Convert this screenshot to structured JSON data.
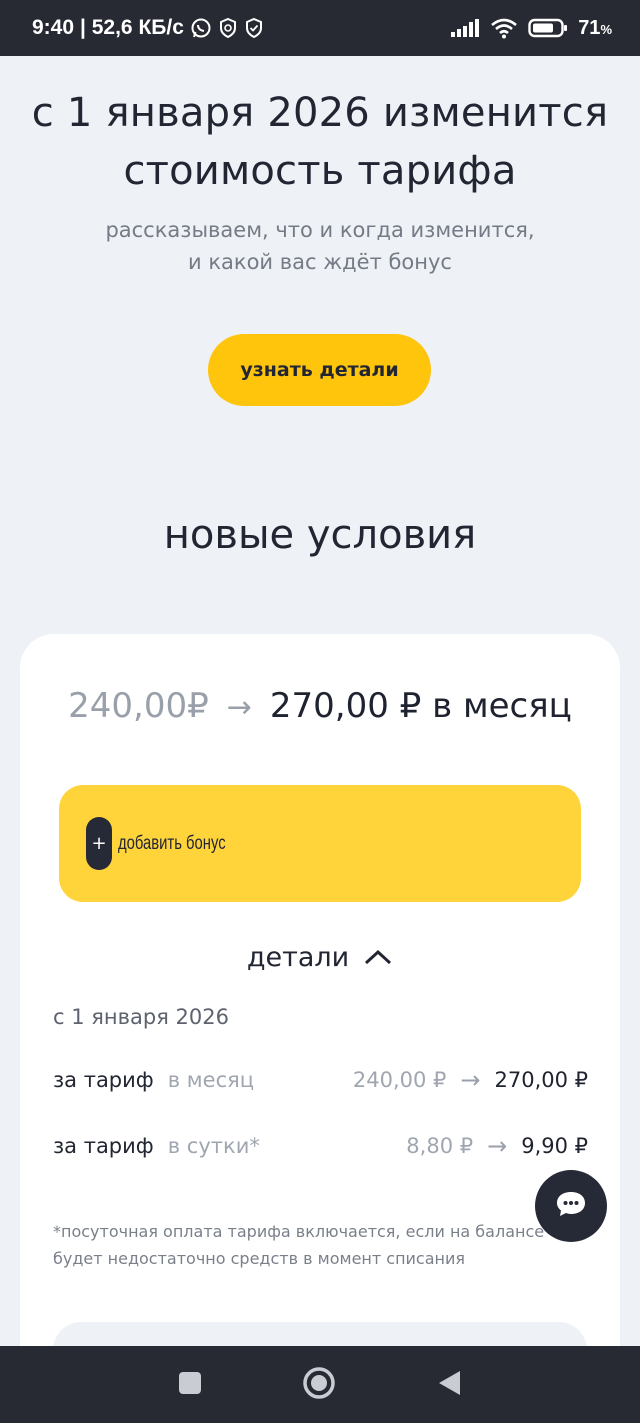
{
  "status_bar": {
    "time": "9:40",
    "speed": "| 52,6 КБ/с",
    "battery_pct": "71",
    "battery_unit": "%",
    "icons": [
      "whatsapp-icon",
      "shield-icon",
      "shield-check-icon",
      "signal-icon",
      "wifi-icon",
      "battery-icon"
    ]
  },
  "hero": {
    "title_line1": "с 1 января 2026 изменится",
    "title_line2": "стоимость тарифа",
    "subtitle_line1": "рассказываем, что и когда изменится,",
    "subtitle_line2": "и какой вас ждёт бонус",
    "button_label": "узнать детали"
  },
  "section": {
    "title": "новые условия"
  },
  "card": {
    "price_old": "240,00₽",
    "price_new": "270,00 ₽ в месяц",
    "bonus_label": "добавить бонус",
    "details_label": "детали",
    "from_date": "с 1 января 2026",
    "rows": [
      {
        "label": "за тариф",
        "period": "в месяц",
        "old": "240,00 ₽",
        "new": "270,00 ₽"
      },
      {
        "label": "за тариф",
        "period": "в сутки*",
        "old": "8,80 ₽",
        "new": "9,90 ₽"
      }
    ],
    "footnote": "*посуточная оплата тарифа включается, если на балансе будет недостаточно средств в момент списания"
  },
  "colors": {
    "accent_button": "#ffc40c",
    "bonus_bg": "#ffd43b",
    "page_bg": "#eef1f5",
    "dark": "#262a36"
  }
}
